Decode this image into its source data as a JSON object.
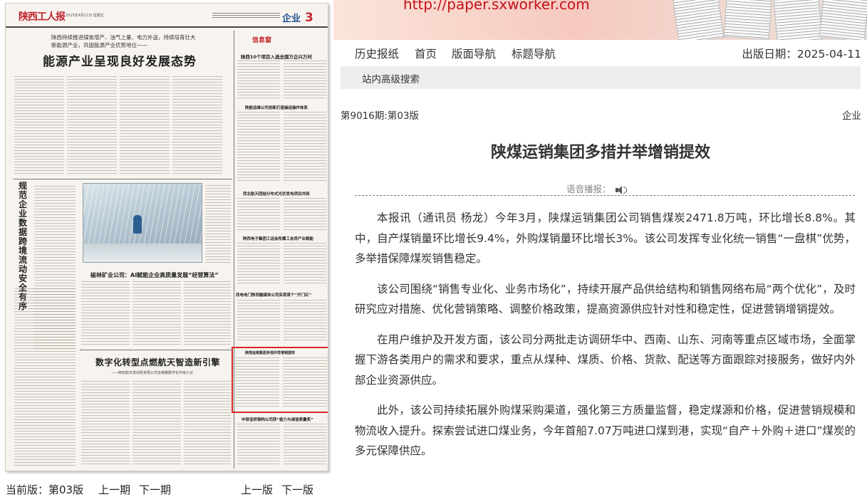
{
  "banner": {
    "url": "http://paper.sxworker.com"
  },
  "newspaper": {
    "masthead": "陕西工人报",
    "issue_date": "2025年4月11日  星期五",
    "section_name": "企业",
    "section_number": "3",
    "lead_subtitle_1": "陕西持续推进煤炭增产、油气上量、电力外送，持续培育壮大",
    "lead_subtitle_2": "新能源产业，巩固能源产业优势地位——",
    "lead_title": "能源产业呈现良好发展态势",
    "xin_badge": "信息窗",
    "headlines": {
      "h1": "陕西10个项目入选全国万企兴万村",
      "h2": "陕能运维公司创新打造操运操作体系",
      "h3": "西北航天团结分布式光伏发电项目并网",
      "h4": "陕西电子集团工运会所属工会员产业赋能",
      "h5": "西电电门陕西融媒体公司实现首个“开门红”",
      "h6": "陕煤运销集团多措并举增销提效",
      "h7": "中铁宝桥钢构公司获“能力与诚信质量奖”"
    },
    "vertical_title": "规范企业数据跨境流动安全有序",
    "mid_title": "榆林矿业公司：AI赋能企业高质量发展“经营算法”",
    "big2_title": "数字化转型点燃航天智造新引擎",
    "big2_sub": "——西安航天发动机有限公司全链路数字化升级小记"
  },
  "left_nav": {
    "current_label": "当前版：第03版",
    "prev_issue": "上一期",
    "next_issue": "下一期",
    "prev_page": "上一版",
    "next_page": "下一版"
  },
  "topnav": {
    "items": [
      "历史报纸",
      "首页",
      "版面导航",
      "标题导航"
    ],
    "pub_date": "出版日期：2025-04-11"
  },
  "search": {
    "label": "站内高级搜索"
  },
  "article": {
    "issue_line": "第9016期:第03版",
    "edition": "企业",
    "title": "陕煤运销集团多措并举增销提效",
    "tts_label": "语音播报：",
    "paragraphs": [
      "本报讯（通讯员 杨龙）今年3月，陕煤运销集团公司销售煤炭2471.8万吨，环比增长8.8%。其中，自产煤销量环比增长9.4%，外购煤销量环比增长3%。该公司发挥专业化统一销售“一盘棋”优势，多举措保障煤炭销售稳定。",
      "该公司围绕“销售专业化、业务市场化”，持续开展产品供给结构和销售网络布局“两个优化”，及时研究应对措施、优化营销策略、调整价格政策，提高资源供应针对性和稳定性，促进营销增销提效。",
      "在用户维护及开发方面，该公司分两批走访调研华中、西南、山东、河南等重点区域市场，全面掌握下游各类用户的需求和要求，重点从煤种、煤质、价格、货款、配送等方面跟踪对接服务，做好内外部企业资源供应。",
      "此外，该公司持续拓展外购煤采购渠道，强化第三方质量监督，稳定煤源和价格，促进营销规模和物流收入提升。探索尝试进口煤业务，今年首船7.07万吨进口煤到港，实现“自产＋外购＋进口”煤炭的多元保障供应。"
    ]
  }
}
